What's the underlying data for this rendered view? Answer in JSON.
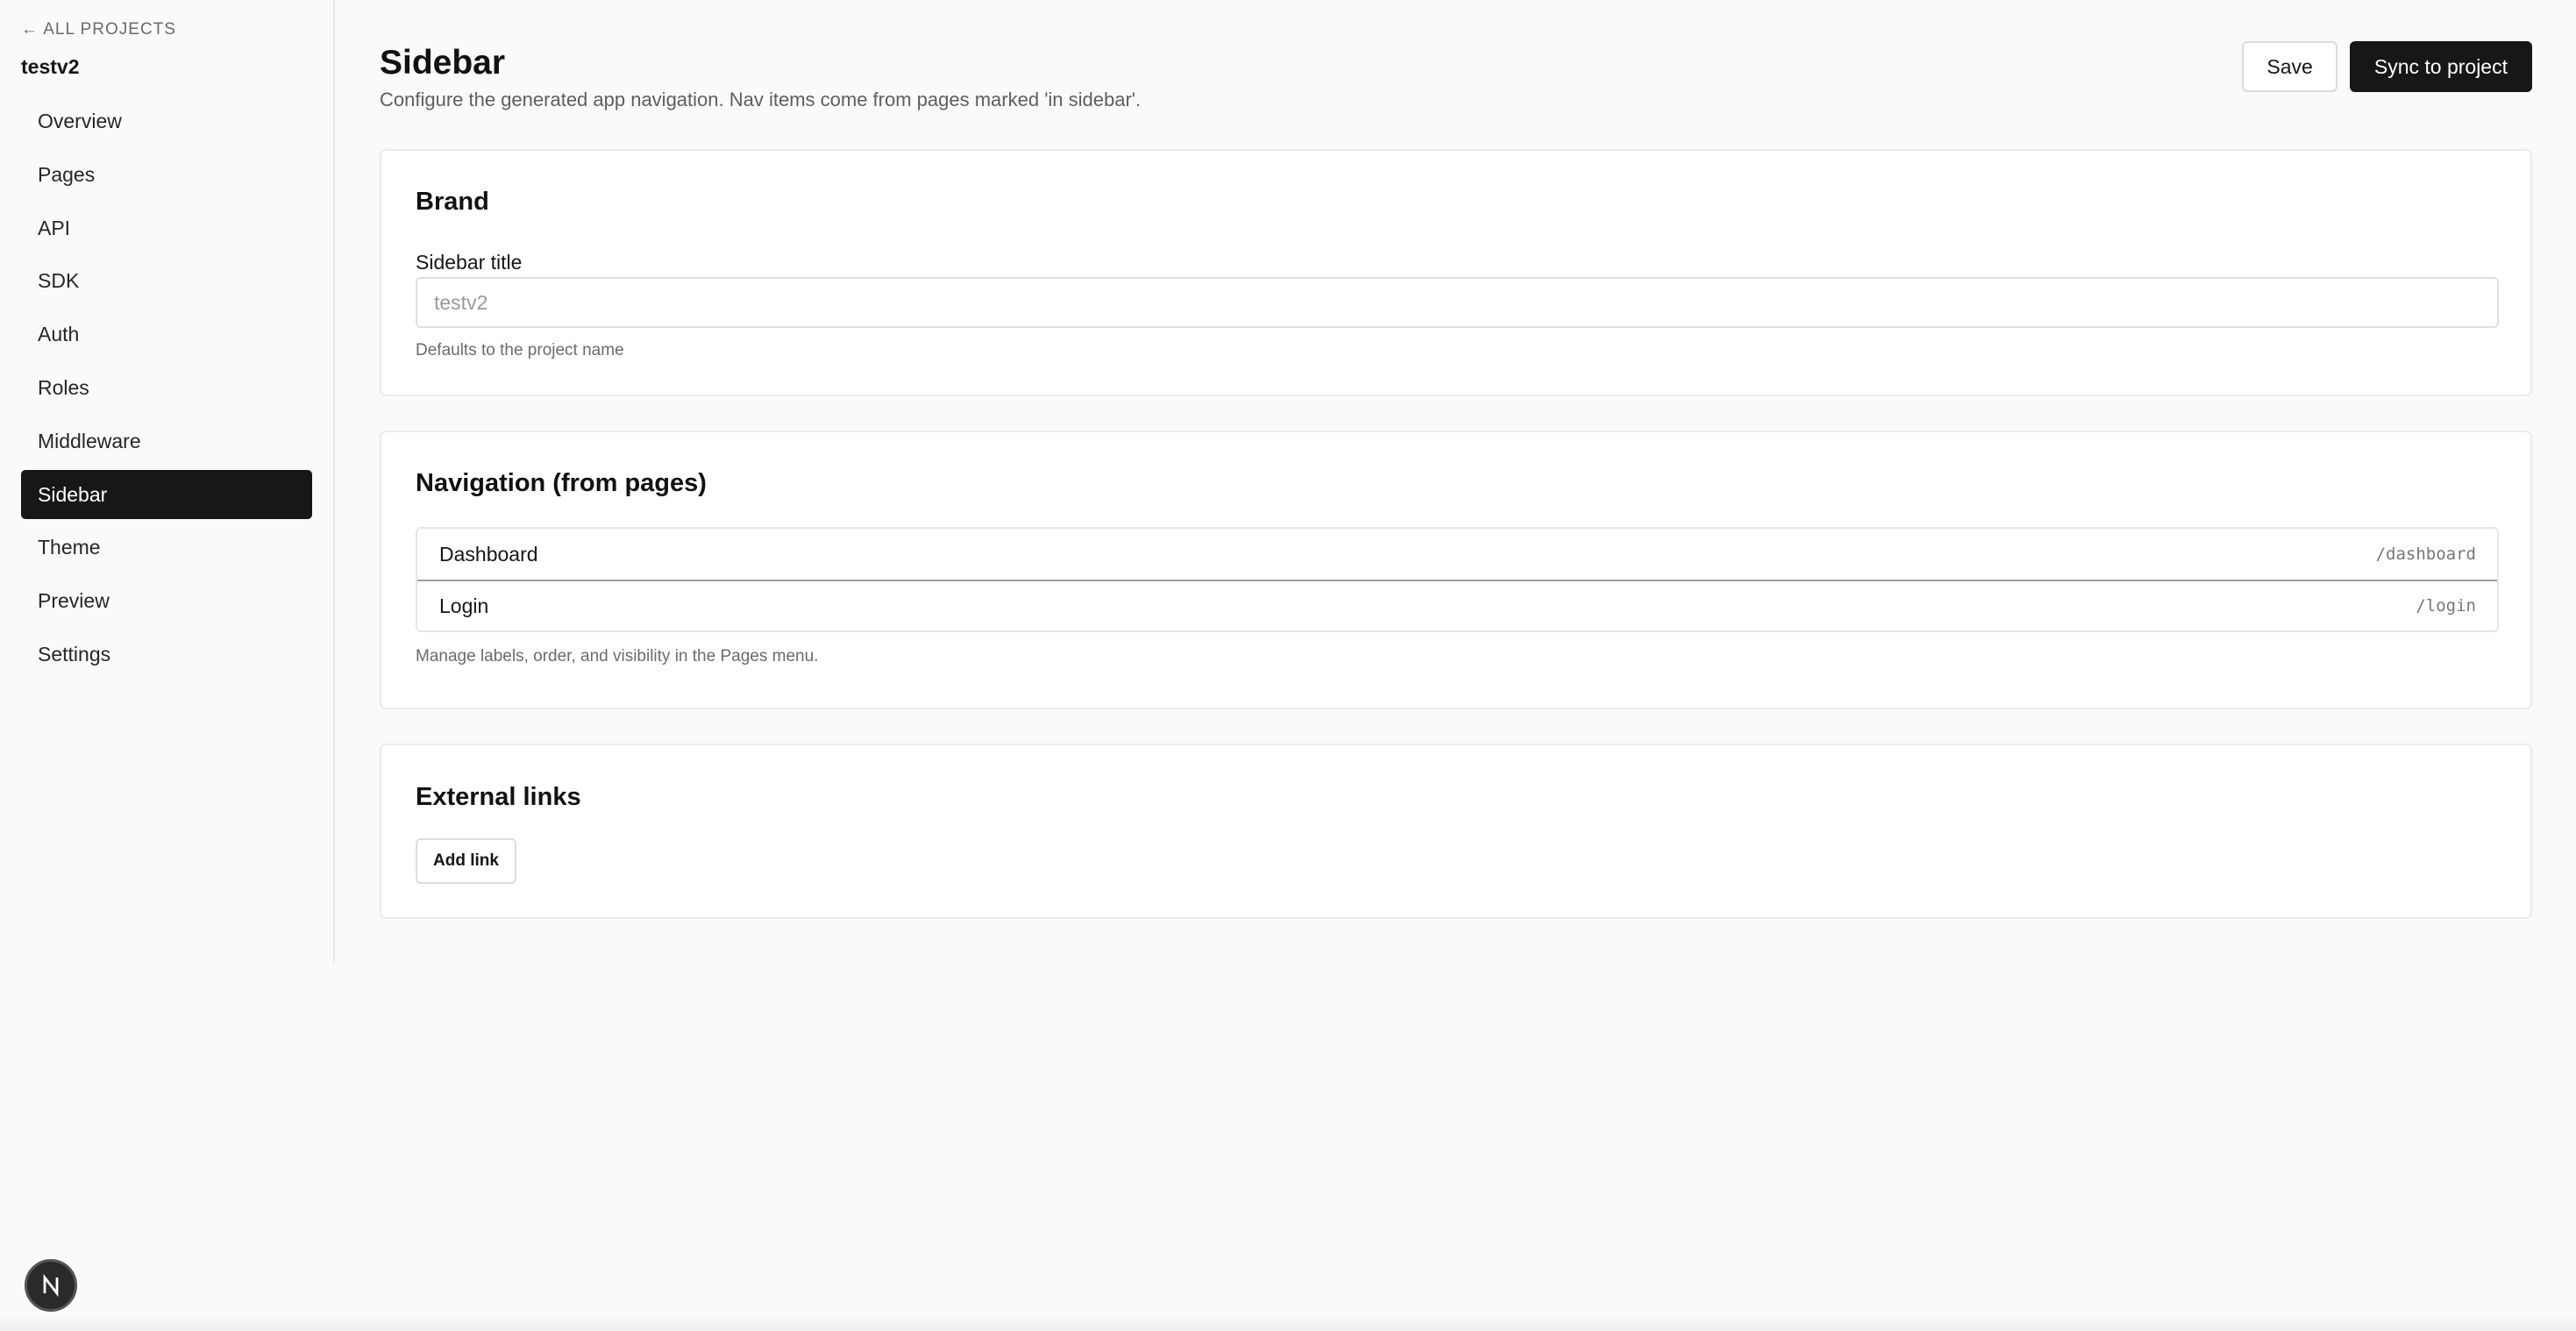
{
  "sidebar": {
    "back_label": "← ALL PROJECTS",
    "project_name": "testv2",
    "items": [
      {
        "label": "Overview"
      },
      {
        "label": "Pages"
      },
      {
        "label": "API"
      },
      {
        "label": "SDK"
      },
      {
        "label": "Auth"
      },
      {
        "label": "Roles"
      },
      {
        "label": "Middleware"
      },
      {
        "label": "Sidebar"
      },
      {
        "label": "Theme"
      },
      {
        "label": "Preview"
      },
      {
        "label": "Settings"
      }
    ],
    "active_item": "Sidebar"
  },
  "header": {
    "title": "Sidebar",
    "subtitle": "Configure the generated app navigation. Nav items come from pages marked 'in sidebar'.",
    "save_label": "Save",
    "sync_label": "Sync to project"
  },
  "brand": {
    "title": "Brand",
    "field_label": "Sidebar title",
    "field_value": "",
    "field_placeholder": "testv2",
    "hint": "Defaults to the project name"
  },
  "navigation": {
    "title": "Navigation (from pages)",
    "items": [
      {
        "label": "Dashboard",
        "path": "/dashboard"
      },
      {
        "label": "Login",
        "path": "/login"
      }
    ],
    "hint": "Manage labels, order, and visibility in the Pages menu."
  },
  "external_links": {
    "title": "External links",
    "add_label": "Add link"
  },
  "dev_badge": {
    "icon": "nextjs-logo-icon"
  }
}
